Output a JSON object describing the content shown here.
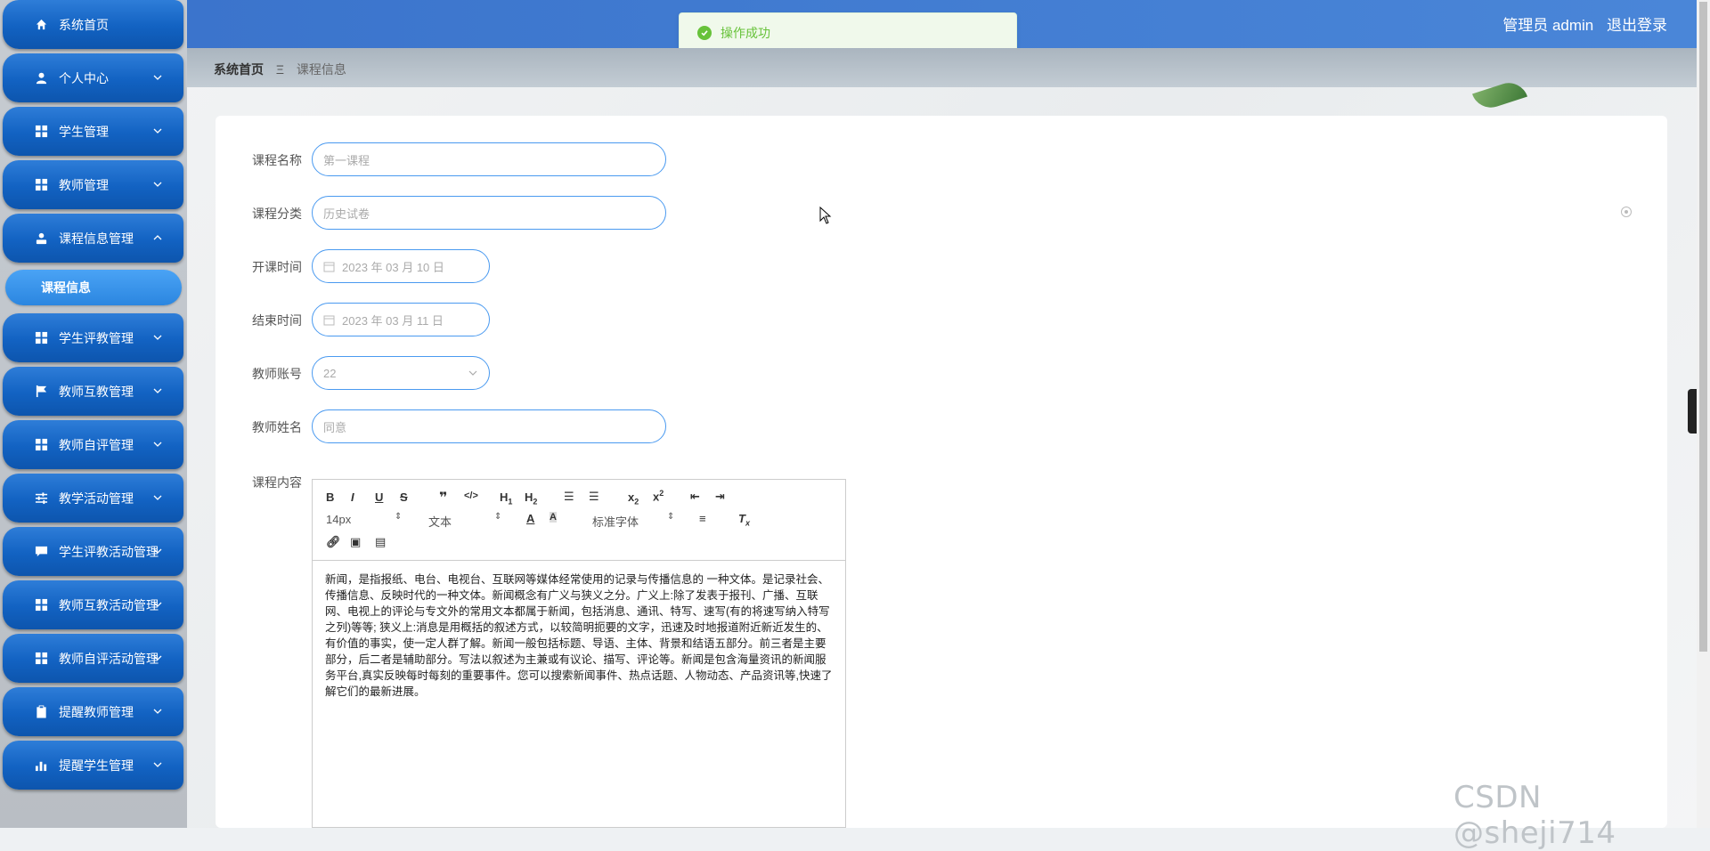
{
  "sidebar": {
    "items": [
      {
        "label": "系统首页",
        "icon": "home-icon",
        "expandable": false
      },
      {
        "label": "个人中心",
        "icon": "user-icon",
        "expandable": true
      },
      {
        "label": "学生管理",
        "icon": "grid-icon",
        "expandable": true
      },
      {
        "label": "教师管理",
        "icon": "grid-icon",
        "expandable": true
      },
      {
        "label": "课程信息管理",
        "icon": "person-badge-icon",
        "expandable": true,
        "expanded": true
      },
      {
        "label": "学生评教管理",
        "icon": "grid-icon",
        "expandable": true
      },
      {
        "label": "教师互教管理",
        "icon": "flag-icon",
        "expandable": true
      },
      {
        "label": "教师自评管理",
        "icon": "grid-icon",
        "expandable": true
      },
      {
        "label": "教学活动管理",
        "icon": "sliders-icon",
        "expandable": true
      },
      {
        "label": "学生评教活动管理",
        "icon": "chat-icon",
        "expandable": true
      },
      {
        "label": "教师互教活动管理",
        "icon": "grid-icon",
        "expandable": true
      },
      {
        "label": "教师自评活动管理",
        "icon": "grid-icon",
        "expandable": true
      },
      {
        "label": "提醒教师管理",
        "icon": "clipboard-icon",
        "expandable": true
      },
      {
        "label": "提醒学生管理",
        "icon": "bar-chart-icon",
        "expandable": true
      }
    ],
    "active_sub": "课程信息"
  },
  "header": {
    "role": "管理员 admin",
    "logout": "退出登录"
  },
  "toast": {
    "message": "操作成功",
    "color": "#67c23a"
  },
  "breadcrumb": {
    "home": "系统首页",
    "separator": "Ξ",
    "current": "课程信息"
  },
  "form": {
    "course_name": {
      "label": "课程名称",
      "value": "第一课程"
    },
    "course_category": {
      "label": "课程分类",
      "value": "历史试卷"
    },
    "start_time": {
      "label": "开课时间",
      "value": "2023 年 03 月 10 日"
    },
    "end_time": {
      "label": "结束时间",
      "value": "2023 年 03 月 11 日"
    },
    "teacher_account": {
      "label": "教师账号",
      "value": "22"
    },
    "teacher_name": {
      "label": "教师姓名",
      "value": "同意"
    },
    "course_content": {
      "label": "课程内容"
    }
  },
  "editor": {
    "font_size": "14px",
    "block_type": "文本",
    "font_family": "标准字体",
    "content": "新闻，是指报纸、电台、电视台、互联网等媒体经常使用的记录与传播信息的 一种文体。是记录社会、传播信息、反映时代的一种文体。新闻概念有广义与狭义之分。广义上:除了发表于报刊、广播、互联网、电视上的评论与专文外的常用文本都属于新闻，包括消息、通讯、特写、速写(有的将速写纳入特写之列)等等; 狭义上:消息是用概括的叙述方式，以较简明扼要的文字，迅速及时地报道附近新近发生的、有价值的事实，使一定人群了解。新闻一般包括标题、导语、主体、背景和结语五部分。前三者是主要部分，后二者是辅助部分。写法以叙述为主兼或有议论、描写、评论等。新闻是包含海量资讯的新闻服务平台,真实反映每时每刻的重要事件。您可以搜索新闻事件、热点话题、人物动态、产品资讯等,快速了解它们的最新进展。"
  },
  "watermark": "CSDN @sheji714",
  "colors": {
    "primary": "#1262c2",
    "accent": "#4a9af0",
    "topbar": "#3b74cc"
  }
}
